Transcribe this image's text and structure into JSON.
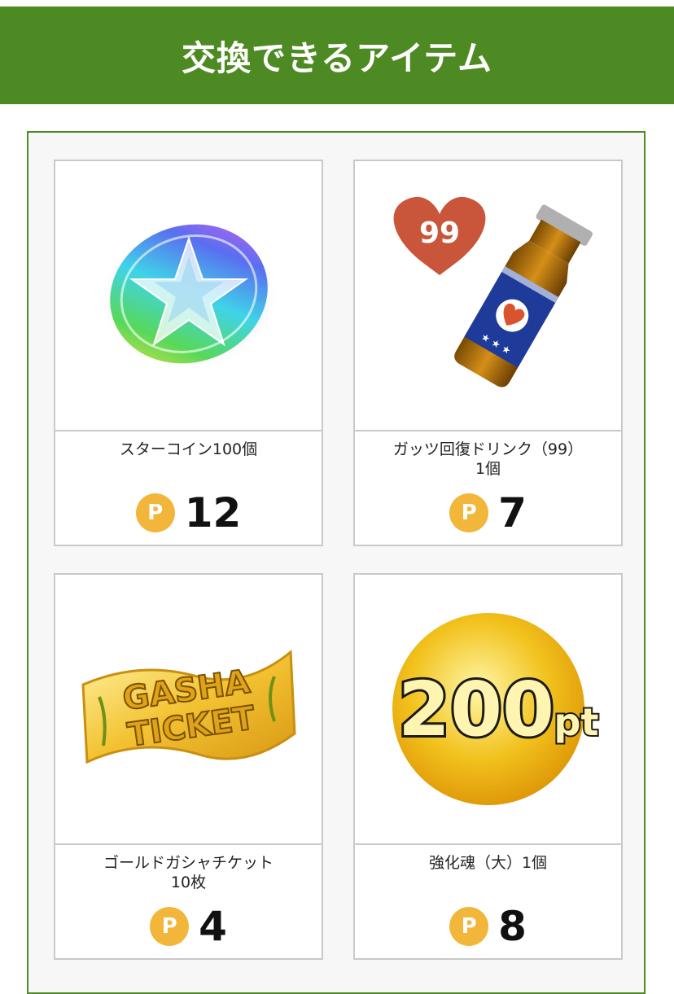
{
  "header": {
    "title": "交換できるアイテム"
  },
  "currency": {
    "badge": "P",
    "badge_color": "#f1b63a"
  },
  "theme": {
    "primary": "#4e8a23",
    "border": "#c9c9c9"
  },
  "items": [
    {
      "name": "スターコイン100個",
      "price": "12",
      "icon": "rainbow-star-coin-icon"
    },
    {
      "name": "ガッツ回復ドリンク（99）\n1個",
      "price": "7",
      "icon": "guts-drink-icon",
      "heart_label": "99"
    },
    {
      "name": "ゴールドガシャチケット\n10枚",
      "price": "4",
      "icon": "gasha-ticket-icon",
      "ticket_text_1": "GASHA",
      "ticket_text_2": "TICKET"
    },
    {
      "name": "強化魂（大）1個",
      "price": "8",
      "icon": "gold-200pt-coin-icon",
      "coin_text": "200",
      "coin_suffix": "pt"
    }
  ]
}
